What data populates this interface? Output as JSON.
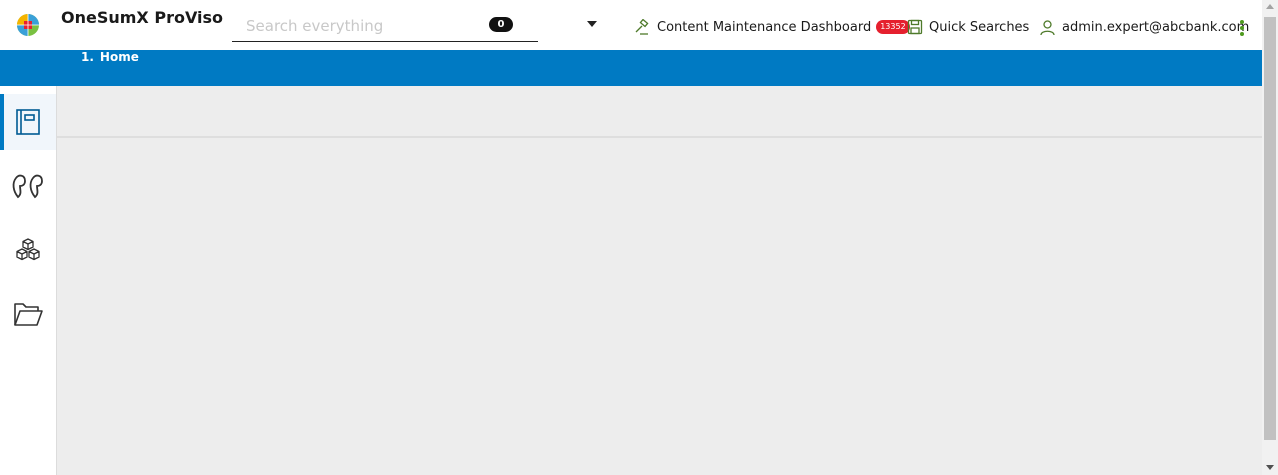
{
  "header": {
    "app_title": "OneSumX ProViso",
    "logo_icon": "globe-logo-icon",
    "search": {
      "placeholder": "Search everything",
      "value": "",
      "count": "0"
    },
    "content_maintenance": {
      "label": "Content Maintenance Dashboard",
      "badge": "13352",
      "icon": "gavel-icon"
    },
    "quick_searches": {
      "label": "Quick Searches",
      "icon": "save-icon"
    },
    "user": {
      "label": "admin.expert@abcbank.com",
      "icon": "user-icon"
    },
    "menu_icon": "kebab-menu-icon"
  },
  "breadcrumb": {
    "items": [
      {
        "number": "1.",
        "label": "Home"
      }
    ]
  },
  "sidebar": {
    "items": [
      {
        "icon": "document-icon",
        "active": true
      },
      {
        "icon": "quote-icon",
        "active": false
      },
      {
        "icon": "cubes-icon",
        "active": false
      },
      {
        "icon": "folder-open-icon",
        "active": false
      }
    ]
  },
  "colors": {
    "brand_blue": "#007ac3",
    "badge_red": "#e5202e",
    "accent_green": "#4e9a1e",
    "content_bg": "#ededed"
  }
}
